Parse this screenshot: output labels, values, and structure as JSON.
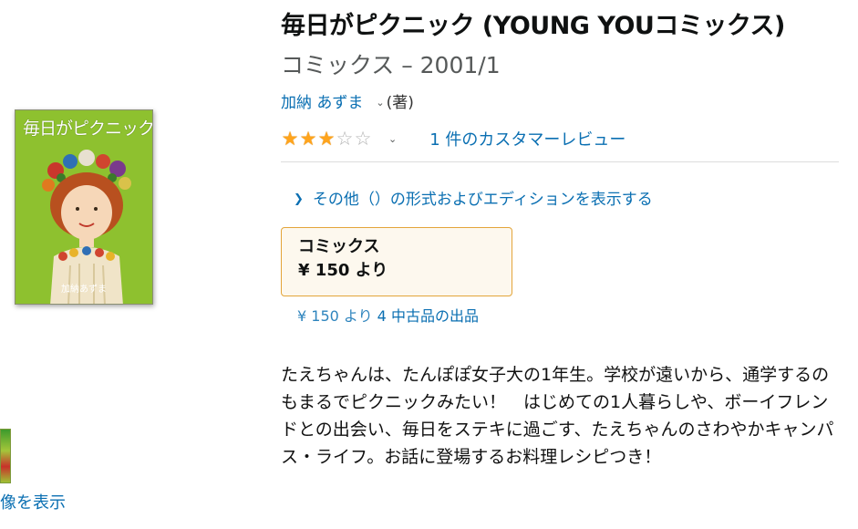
{
  "book": {
    "title": "毎日がピクニック (YOUNG YOUコミックス)",
    "format_and_date": "コミックス – 2001/1",
    "author": "加納 あずま",
    "author_role": "(著)",
    "cover_title": "毎日がピクニック",
    "cover_author": "加納あずま"
  },
  "left_panel": {
    "view_images_label": "像を表示"
  },
  "rating": {
    "stars": 3,
    "max_stars": 5,
    "review_link": "1 件のカスタマーレビュー"
  },
  "other_formats_label": "その他（）の形式およびエディションを表示する",
  "format_option": {
    "type": "コミックス",
    "price": "¥ 150 より"
  },
  "used_offers": {
    "price": "¥ 150 より",
    "count_label": "4 中古品の出品"
  },
  "description": "たえちゃんは、たんぽぽ女子大の1年生。学校が遠いから、通学するのもまるでピクニックみたい！　はじめての1人暮らしや、ボーイフレンドとの出会い、毎日をステキに過ごす、たえちゃんのさわやかキャンパス・ライフ。お話に登場するお料理レシピつき！",
  "colors": {
    "link": "#0a6fb2",
    "star": "#ffa41c",
    "format_border": "#e3a53a",
    "format_bg": "#fdf8ee",
    "cover_green": "#8ec12f"
  }
}
